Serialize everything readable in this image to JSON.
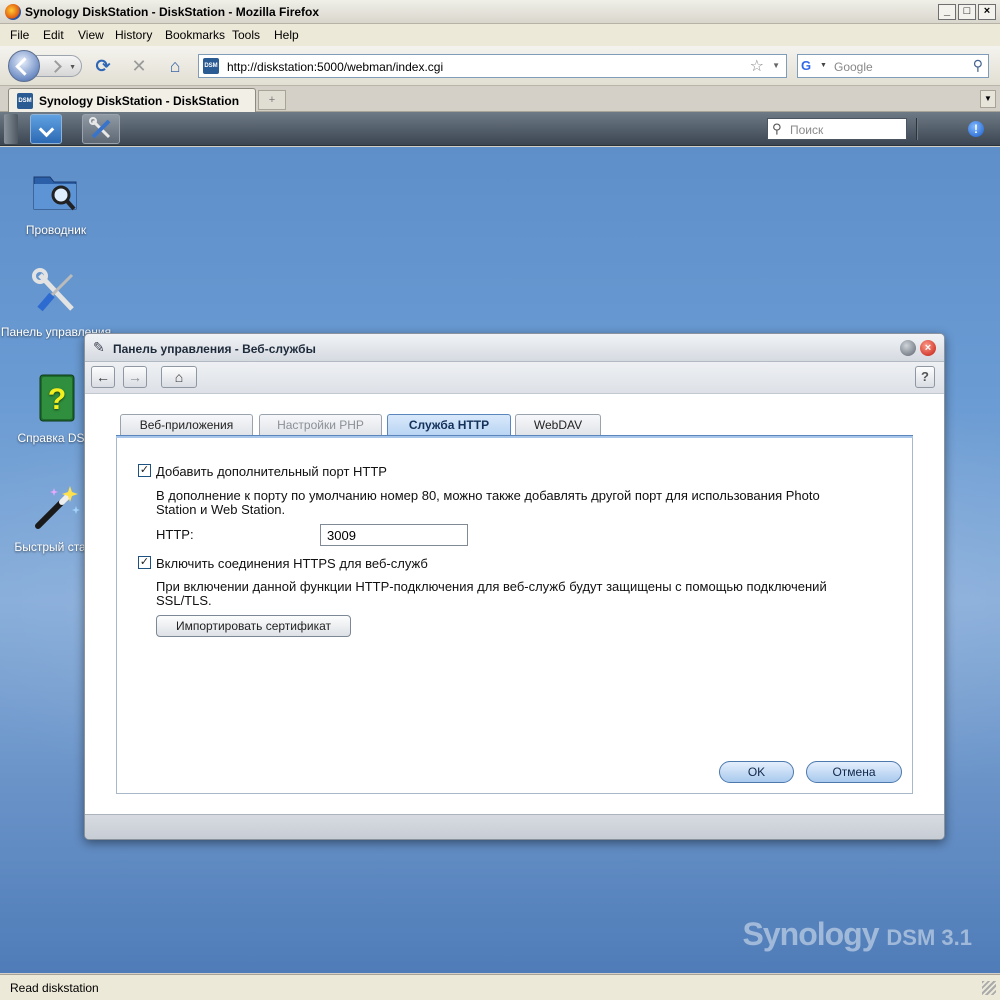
{
  "browser": {
    "window_title": "Synology DiskStation - DiskStation - Mozilla Firefox",
    "menu": [
      "File",
      "Edit",
      "View",
      "History",
      "Bookmarks",
      "Tools",
      "Help"
    ],
    "url": "http://diskstation:5000/webman/index.cgi",
    "search_placeholder": "Google",
    "favicon_text": "DSM",
    "tab_title": "Synology DiskStation - DiskStation",
    "status": "Read diskstation"
  },
  "dsm": {
    "search_placeholder": "Поиск",
    "desktop_icons": [
      {
        "label": "Проводник",
        "icon": "folder-search-icon"
      },
      {
        "label": "Панель управления",
        "icon": "tools-icon"
      },
      {
        "label": "Справка DSM",
        "icon": "help-book-icon"
      },
      {
        "label": "Быстрый старт",
        "icon": "magic-wand-icon"
      }
    ],
    "brand": {
      "name": "Synology",
      "product": "DSM 3.1"
    }
  },
  "window": {
    "title": "Панель управления - Веб-службы",
    "help": "?",
    "tabs": [
      {
        "label": "Веб-приложения",
        "state": "normal"
      },
      {
        "label": "Настройки PHP",
        "state": "disabled"
      },
      {
        "label": "Служба HTTP",
        "state": "active"
      },
      {
        "label": "WebDAV",
        "state": "normal"
      }
    ],
    "http_port": {
      "checked": true,
      "label": "Добавить дополнительный порт HTTP",
      "description_line1": "В дополнение к порту по умолчанию номер 80, можно также добавлять другой порт для использования Photo",
      "description_line2": "Station и Web Station.",
      "field_label": "HTTP:",
      "value": "3009"
    },
    "https": {
      "checked": true,
      "label": "Включить соединения HTTPS для веб-служб",
      "description_line1": "При включении данной функции HTTP-подключения для веб-служб будут защищены с помощью подключений",
      "description_line2": "SSL/TLS.",
      "import_button": "Импортировать сертификат"
    },
    "ok": "OK",
    "cancel": "Отмена"
  }
}
